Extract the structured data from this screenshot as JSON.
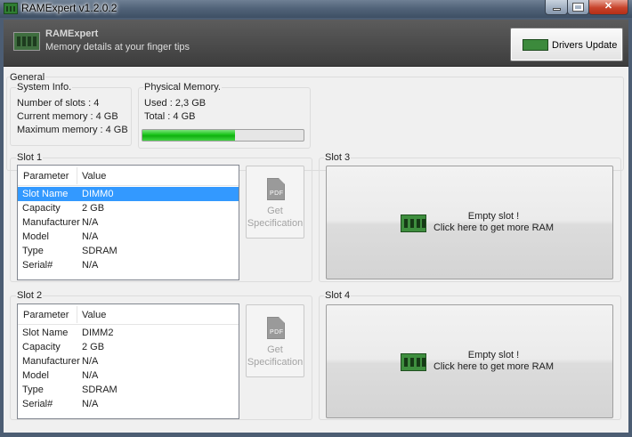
{
  "window": {
    "title": "RAMExpert v1.2.0.2",
    "controls": {
      "minimize": "minimize",
      "maximize": "maximize",
      "close": "✕"
    }
  },
  "header": {
    "app_name": "RAMExpert",
    "tagline": "Memory details at your finger tips",
    "drivers_button": "Drivers Update",
    "icon": "ram-module-icon",
    "bg_color": "#4a4a4a"
  },
  "general": {
    "label": "General",
    "system_info": {
      "label": "System Info.",
      "lines": [
        "Number of slots : 4",
        "Current memory : 4 GB",
        "Maximum memory : 4 GB"
      ]
    },
    "physical_memory": {
      "label": "Physical Memory.",
      "used": "Used : 2,3 GB",
      "total": "Total : 4 GB",
      "usage_fraction": 0.575,
      "bar_color": "#19c419"
    }
  },
  "slots": [
    {
      "label": "Slot 1",
      "columns": [
        "Parameter",
        "Value"
      ],
      "rows": [
        {
          "param": "Slot Name",
          "value": "DIMM0",
          "selected": true
        },
        {
          "param": "Capacity",
          "value": "2 GB"
        },
        {
          "param": "Manufacturer",
          "value": "N/A"
        },
        {
          "param": "Model",
          "value": "N/A"
        },
        {
          "param": "Type",
          "value": "SDRAM"
        },
        {
          "param": "Serial#",
          "value": "N/A"
        }
      ],
      "spec_button": {
        "line1": "Get",
        "line2": "Specification",
        "icon_text": "PDF"
      }
    },
    {
      "label": "Slot 2",
      "columns": [
        "Parameter",
        "Value"
      ],
      "rows": [
        {
          "param": "Slot Name",
          "value": "DIMM2"
        },
        {
          "param": "Capacity",
          "value": "2 GB"
        },
        {
          "param": "Manufacturer",
          "value": "N/A"
        },
        {
          "param": "Model",
          "value": "N/A"
        },
        {
          "param": "Type",
          "value": "SDRAM"
        },
        {
          "param": "Serial#",
          "value": "N/A"
        }
      ],
      "spec_button": {
        "line1": "Get",
        "line2": "Specification",
        "icon_text": "PDF"
      }
    },
    {
      "label": "Slot 3",
      "empty": {
        "line1": "Empty slot !",
        "line2": "Click here to get more RAM",
        "icon": "ram-module-icon"
      }
    },
    {
      "label": "Slot 4",
      "empty": {
        "line1": "Empty slot !",
        "line2": "Click here to get more RAM",
        "icon": "ram-module-icon"
      }
    }
  ],
  "colors": {
    "selection": "#3399ff",
    "frame": "#4c5d73"
  }
}
